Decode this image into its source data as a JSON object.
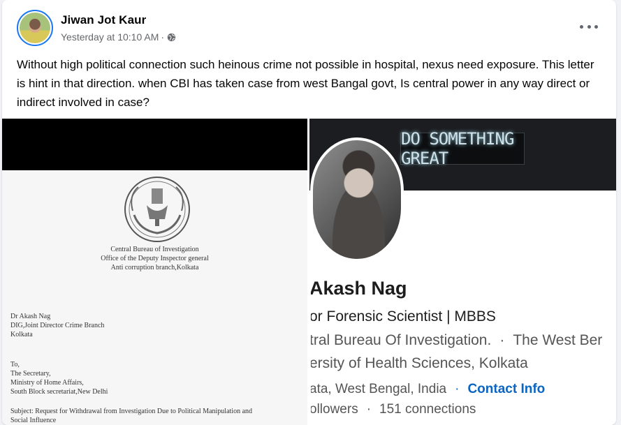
{
  "post": {
    "author": "Jiwan Jot Kaur",
    "timestamp": "Yesterday at 10:10 AM",
    "separator": "·",
    "audience_icon": "globe-icon",
    "more_icon": "more-options-icon",
    "text": "Without high political connection such heinous crime not possible in hospital, nexus need exposure. This letter is hint in that direction. when CBI has taken case from west Bangal govt, Is central power in any way direct or indirect involved in case?"
  },
  "letter": {
    "org_line1": "Central Bureau of Investigation",
    "org_line2": "Office of the Deputy Inspector general",
    "org_line3": "Anti corruption branch,Kolkata",
    "from_line1": "Dr Akash Nag",
    "from_line2": "DIG,Joint Director Crime Branch",
    "from_line3": "Kolkata",
    "to_line0": "To,",
    "to_line1": "The Secretary,",
    "to_line2": "Ministry of Home Affairs,",
    "to_line3": "South Block secretariat,New Delhi",
    "subject_line1": "Subject: Request for Withdrawal from Investigation Due to Political Manipulation and",
    "subject_line2": "Social Influence"
  },
  "profile": {
    "banner_text": "DO SOMETHING GREAT",
    "name": "Akash Nag",
    "headline": "or Forensic Scientist | MBBS",
    "org_left": "tral Bureau Of Investigation.",
    "org_sep": "·",
    "org_right": "The West Ber",
    "edu": "ersity of Health Sciences, Kolkata",
    "location": "ata, West Bengal, India",
    "loc_sep": "·",
    "contact": "Contact Info",
    "followers": "ollowers",
    "conn_sep": "·",
    "connections": "151 connections"
  },
  "colors": {
    "accent": "#1877f2",
    "link": "#0a66c2",
    "text": "#050505",
    "meta": "#65676b"
  }
}
